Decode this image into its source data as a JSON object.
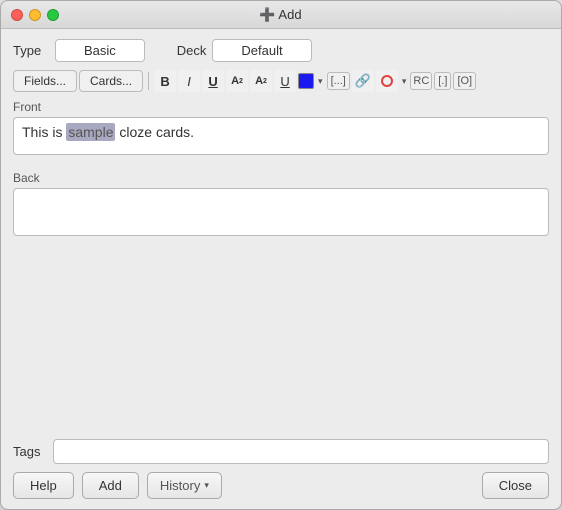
{
  "titleBar": {
    "title": "Add",
    "icon": "➕"
  },
  "typeRow": {
    "label": "Type",
    "options": [
      "Basic",
      "Deck"
    ],
    "activeOption": "Basic",
    "deckLabel": "Deck",
    "deckValue": "Default"
  },
  "toolbar": {
    "fieldsBtn": "Fields...",
    "cardsBtn": "Cards...",
    "boldLabel": "B",
    "italicLabel": "I",
    "underlineLabel": "U",
    "superscriptLabel": "A",
    "subscriptLabel": "A",
    "underlineSpecialLabel": "U̲",
    "colorHex": "#1a1aee",
    "dropdownArrow": "▾",
    "ellipsisLabel": "[...]",
    "attachLabel": "🔗",
    "recordLabel": "RC",
    "bracketLabel": "[.]",
    "squareBracketLabel": "[O]"
  },
  "front": {
    "label": "Front",
    "value": "This is sample cloze cards.",
    "placeholder": ""
  },
  "back": {
    "label": "Back",
    "value": "",
    "placeholder": ""
  },
  "tags": {
    "label": "Tags",
    "value": "",
    "placeholder": ""
  },
  "bottomBar": {
    "helpBtn": "Help",
    "addBtn": "Add",
    "historyBtn": "History",
    "historyArrow": "▾",
    "closeBtn": "Close"
  }
}
